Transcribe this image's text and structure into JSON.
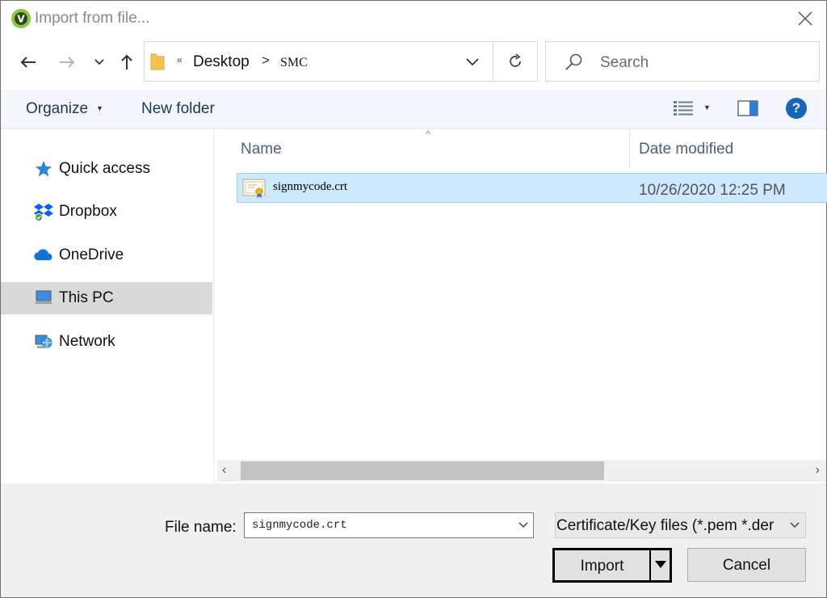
{
  "window": {
    "title": "Import from file..."
  },
  "address": {
    "crumbs": [
      "Desktop",
      "SMC"
    ],
    "overflow": "«",
    "separator": ">"
  },
  "search": {
    "placeholder": "Search"
  },
  "toolbar": {
    "organize_label": "Organize",
    "new_folder_label": "New folder",
    "help_label": "?"
  },
  "sidebar": {
    "items": [
      {
        "label": "Quick access",
        "icon": "star-icon"
      },
      {
        "label": "Dropbox",
        "icon": "dropbox-icon"
      },
      {
        "label": "OneDrive",
        "icon": "onedrive-icon"
      },
      {
        "label": "This PC",
        "icon": "computer-icon",
        "selected": true
      },
      {
        "label": "Network",
        "icon": "network-icon"
      }
    ]
  },
  "file_list": {
    "columns": [
      "Name",
      "Date modified"
    ],
    "rows": [
      {
        "name": "signmycode.crt",
        "date_modified": "10/26/2020 12:25 PM",
        "icon": "certificate-icon",
        "selected": true
      }
    ]
  },
  "bottom": {
    "file_name_label": "File name:",
    "file_name_value": "signmycode.crt",
    "filter_value": "Certificate/Key files (*.pem *.der",
    "import_label": "Import",
    "cancel_label": "Cancel"
  },
  "colors": {
    "selection": "#cde8ff",
    "toolbar_bg": "#f3f6fb",
    "help_blue": "#1565c0"
  }
}
